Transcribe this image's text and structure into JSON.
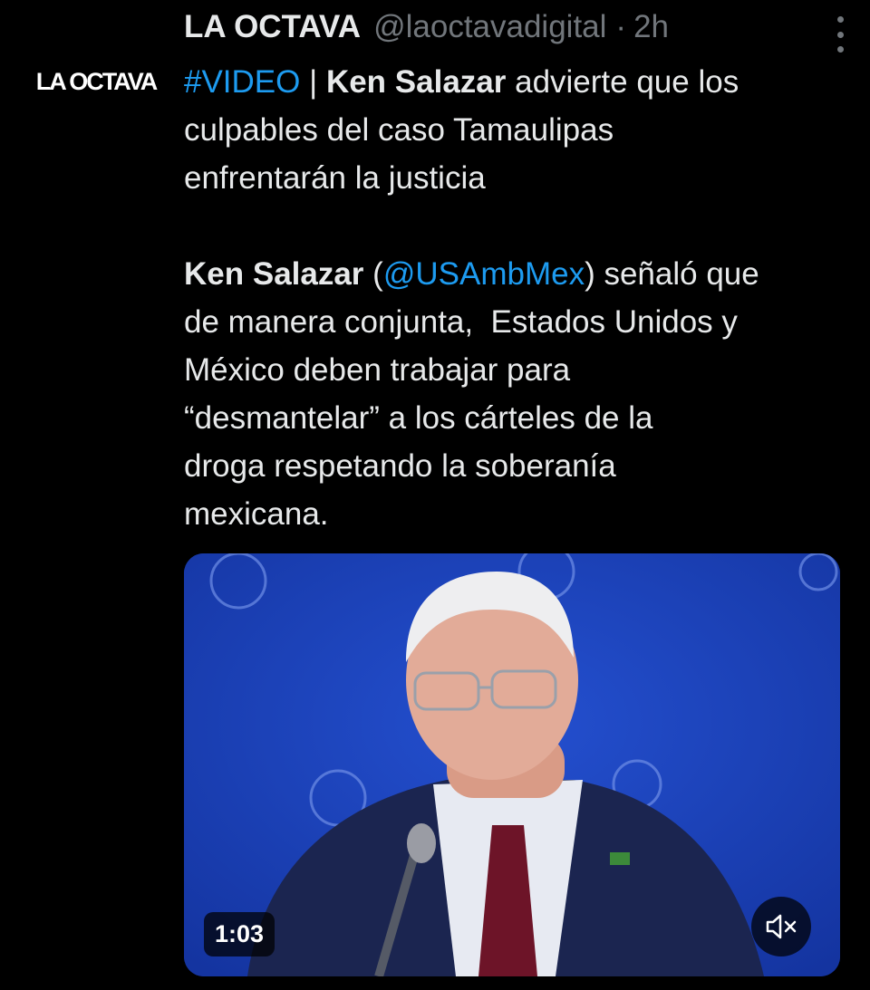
{
  "account": {
    "avatar_text": "LA OCTAVA",
    "display_name": "LA OCTAVA",
    "handle": "@laoctavadigital",
    "separator": "·",
    "time": "2h"
  },
  "tweet": {
    "line1": {
      "hashtag": "#VIDEO",
      "sep": " | ",
      "bold": "Ken Salazar",
      "rest": " advierte que los"
    },
    "line2": "culpables del caso Tamaulipas",
    "line3": "enfrentarán la justicia",
    "line4": {
      "bold": "Ken Salazar",
      "open": " (",
      "mention": "@USAmbMex",
      "rest": ") señaló que"
    },
    "line5": "de manera conjunta,  Estados Unidos y",
    "line6": "México deben trabajar para",
    "line7": "“desmantelar” a los cárteles de la",
    "line8": "droga respetando la soberanía",
    "line9": "mexicana."
  },
  "video": {
    "duration": "1:03",
    "mute_icon": "speaker-muted-icon"
  },
  "colors": {
    "link": "#1d9bf0",
    "muted_text": "#71767b",
    "text": "#e7e9ea",
    "background": "#000000",
    "video_bg": "#1a3fb6"
  }
}
